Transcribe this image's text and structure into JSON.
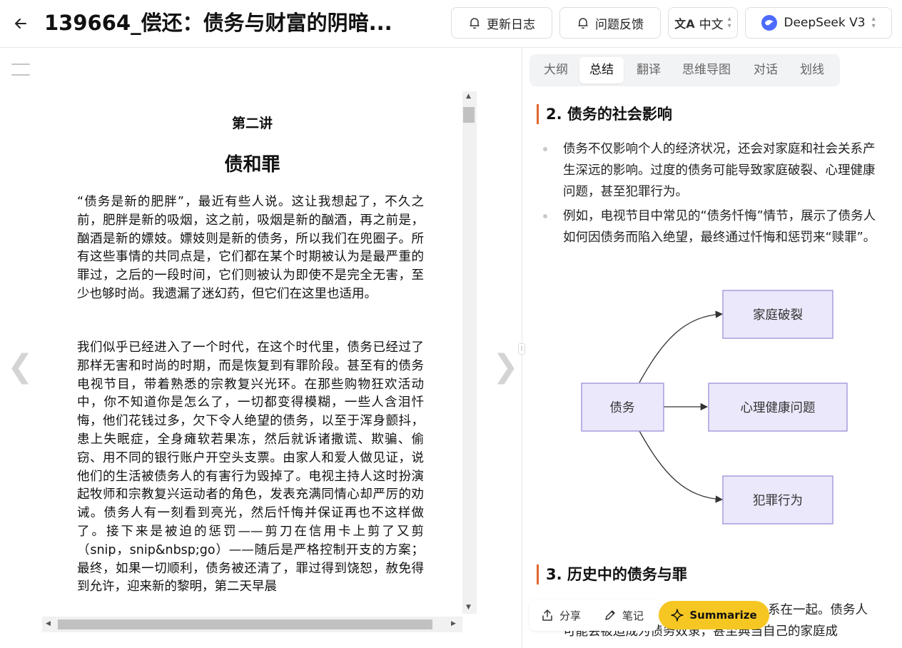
{
  "header": {
    "title": "139664_偿还：债务与财富的阴暗...",
    "changelog_label": "更新日志",
    "feedback_label": "问题反馈",
    "language_label": "中文",
    "model_label": "DeepSeek V3"
  },
  "document": {
    "chapter": "第二讲",
    "title": "债和罪",
    "paragraphs": [
      "“债务是新的肥胖”，最近有些人说。这让我想起了，不久之前，肥胖是新的吸烟，这之前，吸烟是新的酗酒，再之前是，酗酒是新的嫖妓。嫖妓则是新的债务，所以我们在兜圈子。所有这些事情的共同点是，它们都在某个时期被认为是最严重的罪过，之后的一段时间，它们则被认为即使不是完全无害，至少也够时尚。我遗漏了迷幻药，但它们在这里也适用。",
      "我们似乎已经进入了一个时代，在这个时代里，债务已经过了那样无害和时尚的时期，而是恢复到有罪阶段。甚至有的债务电视节目，带着熟悉的宗教复兴光环。在那些购物狂欢活动中，你不知道你是怎么了，一切都变得模糊，一些人含泪忏悔，他们花钱过多，欠下令人绝望的债务，以至于浑身颤抖，患上失眠症，全身瘫软若果冻，然后就诉诸撒谎、欺骗、偷窃、用不同的银行账户开空头支票。由家人和爱人做见证，说他们的生活被债务人的有害行为毁掉了。电视主持人这时扮演起牧师和宗教复兴运动者的角色，发表充满同情心却严厉的劝诫。债务人有一刻看到亮光，然后忏悔并保证再也不这样做了。接下来是被迫的惩罚——剪刀在信用卡上剪了又剪（snip，snip&nbsp;go）——随后是严格控制开支的方案；最终，如果一切顺利，债务被还清了，罪过得到饶恕，赦免得到允许，迎来新的黎明，第二天早晨"
    ]
  },
  "tabs": [
    {
      "label": "大纲",
      "active": false
    },
    {
      "label": "总结",
      "active": true
    },
    {
      "label": "翻译",
      "active": false
    },
    {
      "label": "思维导图",
      "active": false
    },
    {
      "label": "对话",
      "active": false
    },
    {
      "label": "划线",
      "active": false
    }
  ],
  "summary": {
    "section2_title": "2. 债务的社会影响",
    "section2_bullets": [
      "债务不仅影响个人的经济状况，还会对家庭和社会关系产生深远的影响。过度的债务可能导致家庭破裂、心理健康问题，甚至犯罪行为。",
      "例如，电视节目中常见的“债务忏悔”情节，展示了债务人如何因债务而陷入绝望，最终通过忏悔和惩罚来“赎罪”。"
    ],
    "diagram": {
      "source": "债务",
      "targets": [
        "家庭破裂",
        "心理健康问题",
        "犯罪行为"
      ]
    },
    "section3_title": "3. 历史中的债务与罪",
    "section3_partial_line1": "系在一起。债务人",
    "section3_partial_line2": "可能会被迫成为债务奴隶，甚至典当自己的家庭成"
  },
  "toolbar": {
    "share_label": "分享",
    "notes_label": "笔记",
    "summarize_label": "Summarize"
  },
  "colors": {
    "accent": "#e0662d",
    "summarize_bg": "#f6c623",
    "node_fill": "#ece8fb",
    "node_stroke": "#9c8ed8",
    "deepseek": "#4d6bfe"
  },
  "icons": [
    "back-arrow-icon",
    "bell-icon",
    "translate-icon",
    "deepseek-logo-icon",
    "menu-icon",
    "share-icon",
    "pen-icon",
    "sparkle-icon"
  ]
}
